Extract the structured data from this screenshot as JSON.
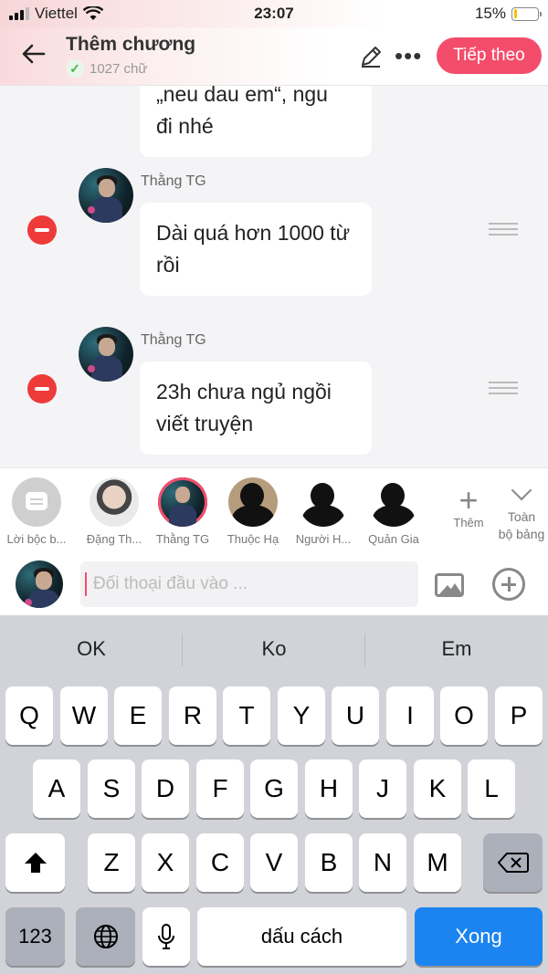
{
  "status_bar": {
    "carrier": "Viettel",
    "time": "23:07",
    "battery": "15%"
  },
  "header": {
    "title": "Thêm chương",
    "word_count": "1027 chữ",
    "next_label": "Tiếp theo"
  },
  "messages": [
    {
      "sender": "",
      "text": "đi nhé",
      "partial_top": "„neu dau em“, ngu"
    },
    {
      "sender": "Thằng TG",
      "text": "Dài quá hơn 1000 từ rồi"
    },
    {
      "sender": "Thằng TG",
      "text": "23h chưa ngủ ngồi viết truyện"
    }
  ],
  "characters": [
    {
      "name": "Lời bộc b...",
      "type": "note"
    },
    {
      "name": "Đặng Th...",
      "type": "photo"
    },
    {
      "name": "Thằng TG",
      "type": "selected"
    },
    {
      "name": "Thuộc Hạ",
      "type": "silhouette"
    },
    {
      "name": "Người H...",
      "type": "silhouette"
    },
    {
      "name": "Quản Gia",
      "type": "silhouette"
    }
  ],
  "add_character_label": "Thêm",
  "all_board_label_1": "Toàn",
  "all_board_label_2": "bộ bảng",
  "input": {
    "placeholder": "Đối thoại đầu vào ..."
  },
  "keyboard": {
    "suggestions": [
      "OK",
      "Ko",
      "Em"
    ],
    "row1": [
      "Q",
      "W",
      "E",
      "R",
      "T",
      "Y",
      "U",
      "I",
      "O",
      "P"
    ],
    "row2": [
      "A",
      "S",
      "D",
      "F",
      "G",
      "H",
      "J",
      "K",
      "L"
    ],
    "row3": [
      "Z",
      "X",
      "C",
      "V",
      "B",
      "N",
      "M"
    ],
    "numbers_label": "123",
    "space_label": "dấu cách",
    "return_label": "Xong"
  },
  "colors": {
    "accent": "#f44d6c",
    "remove": "#ef3a3a",
    "keyboard_blue": "#1c84f0"
  }
}
